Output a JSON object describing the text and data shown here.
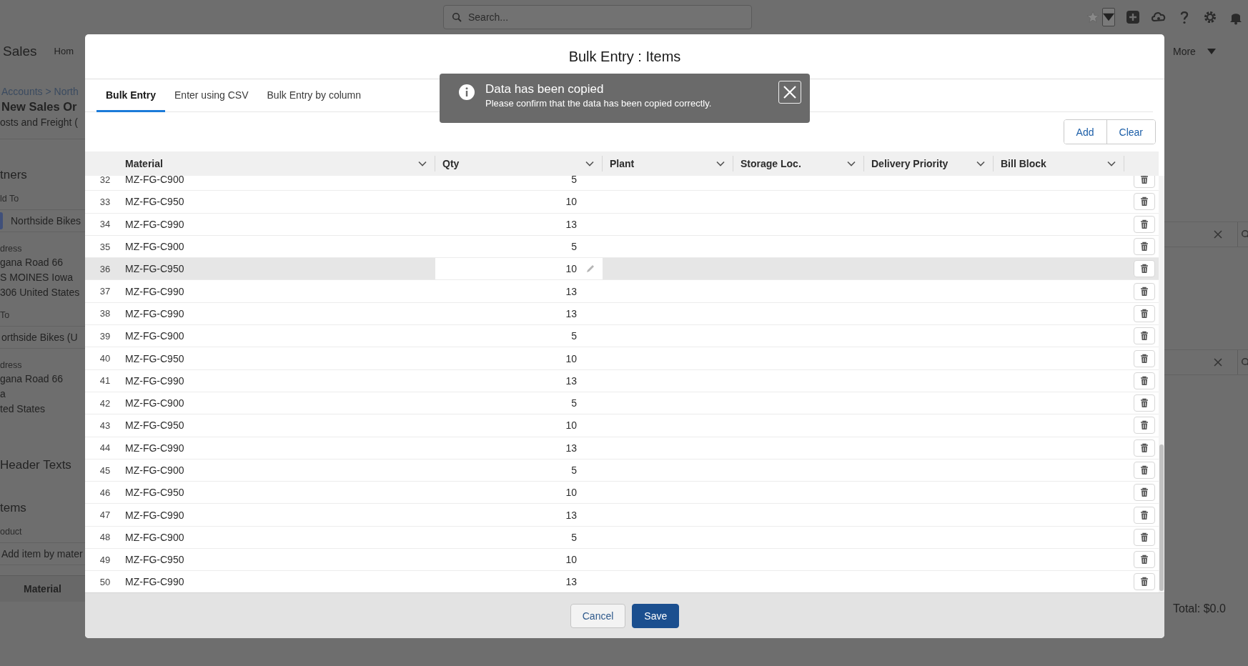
{
  "global_search": {
    "placeholder": "Search..."
  },
  "nav": {
    "app_name": "Sales",
    "items": [
      "Hom"
    ],
    "more": "More"
  },
  "record_panel": [
    {
      "kind": "link",
      "text": "Accounts > North"
    },
    {
      "kind": "title",
      "text": "New Sales Or"
    },
    {
      "kind": "text",
      "text": "osts and Freight ("
    },
    {
      "kind": "heading",
      "text": "tners"
    },
    {
      "kind": "label",
      "text": "ld To"
    },
    {
      "kind": "lookup",
      "text": "Northside Bikes"
    },
    {
      "kind": "label",
      "text": "dress"
    },
    {
      "kind": "text",
      "text": "gana Road 66"
    },
    {
      "kind": "text",
      "text": "S MOINES Iowa"
    },
    {
      "kind": "text",
      "text": "306 United States"
    },
    {
      "kind": "label",
      "text": "To"
    },
    {
      "kind": "field",
      "text": "orthside Bikes (U"
    },
    {
      "kind": "label",
      "text": "dress"
    },
    {
      "kind": "text",
      "text": "gana Road 66"
    },
    {
      "kind": "text",
      "text": "a"
    },
    {
      "kind": "text",
      "text": "ted States"
    },
    {
      "kind": "section",
      "text": "Header Texts"
    },
    {
      "kind": "heading",
      "text": "tems"
    },
    {
      "kind": "label",
      "text": "oduct"
    },
    {
      "kind": "field",
      "text": "Add item by mater"
    },
    {
      "kind": "column_header",
      "text": "Material"
    }
  ],
  "total": "Total: $0.0",
  "modal": {
    "title": "Bulk Entry : Items",
    "tabs": [
      {
        "label": "Bulk Entry",
        "selected": true
      },
      {
        "label": "Enter using CSV",
        "selected": false
      },
      {
        "label": "Bulk Entry by column",
        "selected": false
      }
    ],
    "toast": {
      "title": "Data has been copied",
      "message": "Please confirm that the data has been copied correctly."
    },
    "actions": [
      "Add",
      "Clear"
    ],
    "table": {
      "columns": [
        "Material",
        "Qty",
        "Plant",
        "Storage Loc.",
        "Delivery Priority",
        "Bill Block"
      ],
      "rows": [
        {
          "number": "32",
          "material": "MZ-FG-C900",
          "qty": "5",
          "hovered": false
        },
        {
          "number": "33",
          "material": "MZ-FG-C950",
          "qty": "10",
          "hovered": false
        },
        {
          "number": "34",
          "material": "MZ-FG-C990",
          "qty": "13",
          "hovered": false
        },
        {
          "number": "35",
          "material": "MZ-FG-C900",
          "qty": "5",
          "hovered": false
        },
        {
          "number": "36",
          "material": "MZ-FG-C950",
          "qty": "10",
          "hovered": true
        },
        {
          "number": "37",
          "material": "MZ-FG-C990",
          "qty": "13",
          "hovered": false
        },
        {
          "number": "38",
          "material": "MZ-FG-C990",
          "qty": "13",
          "hovered": false
        },
        {
          "number": "39",
          "material": "MZ-FG-C900",
          "qty": "5",
          "hovered": false
        },
        {
          "number": "40",
          "material": "MZ-FG-C950",
          "qty": "10",
          "hovered": false
        },
        {
          "number": "41",
          "material": "MZ-FG-C990",
          "qty": "13",
          "hovered": false
        },
        {
          "number": "42",
          "material": "MZ-FG-C900",
          "qty": "5",
          "hovered": false
        },
        {
          "number": "43",
          "material": "MZ-FG-C950",
          "qty": "10",
          "hovered": false
        },
        {
          "number": "44",
          "material": "MZ-FG-C990",
          "qty": "13",
          "hovered": false
        },
        {
          "number": "45",
          "material": "MZ-FG-C900",
          "qty": "5",
          "hovered": false
        },
        {
          "number": "46",
          "material": "MZ-FG-C950",
          "qty": "10",
          "hovered": false
        },
        {
          "number": "47",
          "material": "MZ-FG-C990",
          "qty": "13",
          "hovered": false
        },
        {
          "number": "48",
          "material": "MZ-FG-C900",
          "qty": "5",
          "hovered": false
        },
        {
          "number": "49",
          "material": "MZ-FG-C950",
          "qty": "10",
          "hovered": false
        },
        {
          "number": "50",
          "material": "MZ-FG-C990",
          "qty": "13",
          "hovered": false
        }
      ]
    },
    "footer_buttons": [
      {
        "label": "Cancel",
        "kind": "neutral"
      },
      {
        "label": "Save",
        "kind": "brand"
      }
    ]
  }
}
